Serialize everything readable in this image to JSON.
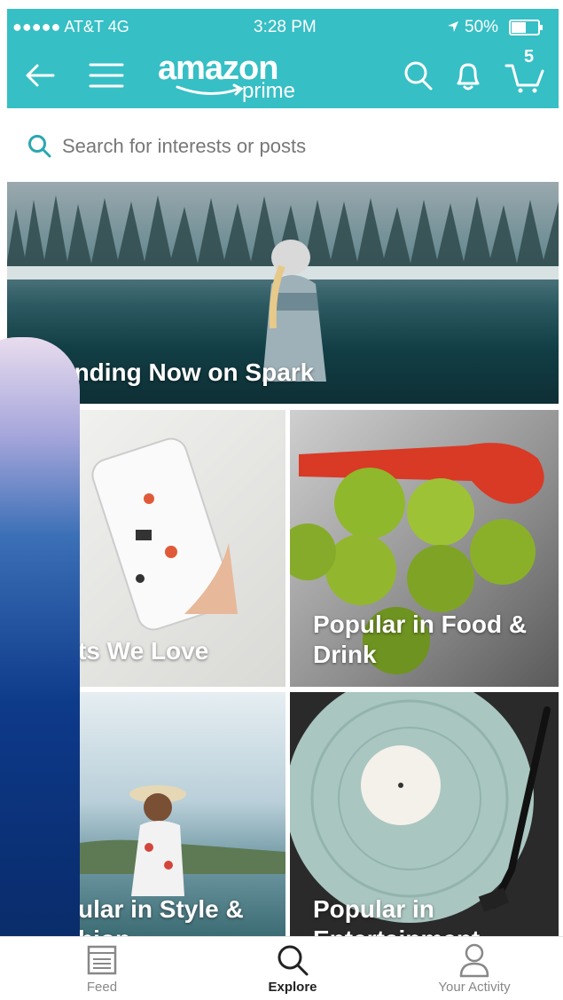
{
  "status_bar": {
    "carrier": "●●●●● AT&T  4G",
    "time": "3:28 PM",
    "battery": "50%"
  },
  "nav": {
    "logo_word": "amazon",
    "logo_sub": "prime",
    "cart_count": "5",
    "icons": [
      "back-arrow-icon",
      "hamburger-icon",
      "search-icon",
      "bell-icon",
      "cart-icon"
    ]
  },
  "search": {
    "placeholder": "Search for interests or posts"
  },
  "tiles": [
    {
      "label": "ending Now on Spark"
    },
    {
      "label": "ts We Love"
    },
    {
      "label": "Popular in Food & Drink"
    },
    {
      "label": "ular in Style & hion"
    },
    {
      "label": "Popular in Entertainment"
    }
  ],
  "tabs": [
    {
      "label": "Feed",
      "icon": "feed-icon"
    },
    {
      "label": "Explore",
      "icon": "search-icon",
      "active": true
    },
    {
      "label": "Your Activity",
      "icon": "person-icon"
    }
  ],
  "colors": {
    "accent": "#36bfc5",
    "text": "#222222",
    "muted": "#888888",
    "search_icon": "#2aa7b0"
  }
}
